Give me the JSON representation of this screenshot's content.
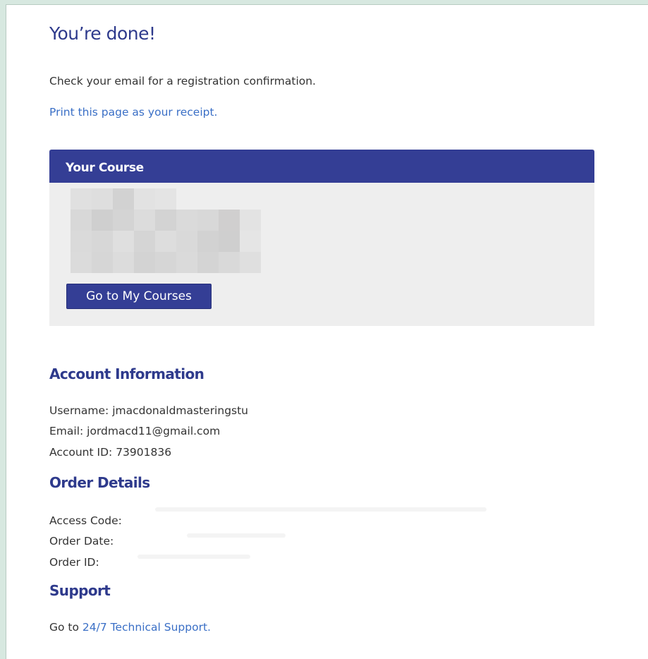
{
  "page": {
    "title": "You’re done!",
    "confirmation_text": "Check your email for a registration confirmation.",
    "print_link": "Print this page as your receipt."
  },
  "course": {
    "header": "Your Course",
    "button_label": "Go to My Courses"
  },
  "account": {
    "heading": "Account Information",
    "username_label": "Username:",
    "username_value": "jmacdonaldmasteringstu",
    "email_label": "Email:",
    "email_value": "jordmacd11@gmail.com",
    "account_id_label": "Account ID:",
    "account_id_value": "73901836"
  },
  "order": {
    "heading": "Order Details",
    "access_code_label": "Access Code:",
    "order_date_label": "Order Date:",
    "order_id_label": "Order ID:"
  },
  "support": {
    "heading": "Support",
    "prefix": "Go to",
    "link_label": "24/7 Technical Support."
  }
}
